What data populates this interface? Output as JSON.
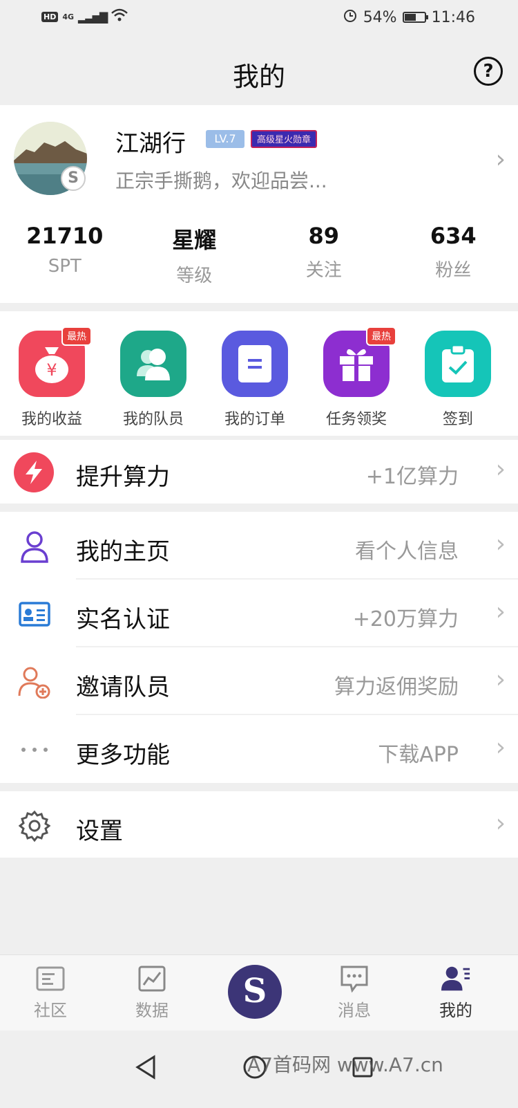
{
  "status_bar": {
    "left_badge": "HD",
    "network": "4G",
    "battery": "54%",
    "time": "11:46"
  },
  "header": {
    "title": "我的",
    "help_label": "?"
  },
  "profile": {
    "name": "江湖行",
    "level_badge": "LV.7",
    "medal_badge": "高级星火勋章",
    "motto": "正宗手撕鹅，欢迎品尝...",
    "stats": [
      {
        "value": "21710",
        "label": "SPT"
      },
      {
        "value": "星耀",
        "label": "等级"
      },
      {
        "value": "89",
        "label": "关注"
      },
      {
        "value": "634",
        "label": "粉丝"
      }
    ]
  },
  "quick_actions": [
    {
      "label": "我的收益",
      "icon": "money-bag-icon",
      "color": "#f0485c",
      "badge": "最热"
    },
    {
      "label": "我的队员",
      "icon": "team-members-icon",
      "color": "#1ea889",
      "badge": ""
    },
    {
      "label": "我的订单",
      "icon": "order-icon",
      "color": "#5a5adf",
      "badge": ""
    },
    {
      "label": "任务领奖",
      "icon": "gift-icon",
      "color": "#8d2ed0",
      "badge": "最热"
    },
    {
      "label": "签到",
      "icon": "clipboard-check-icon",
      "color": "#15c5b8",
      "badge": ""
    }
  ],
  "boost": {
    "title": "提升算力",
    "value": "+1亿算力",
    "icon": "lightning-icon",
    "color": "#f0485c"
  },
  "menu": [
    {
      "title": "我的主页",
      "value": "看个人信息",
      "icon": "person-icon",
      "color": "#6a3fd0"
    },
    {
      "title": "实名认证",
      "value": "+20万算力",
      "icon": "id-card-icon",
      "color": "#2a7bd6"
    },
    {
      "title": "邀请队员",
      "value": "算力返佣奖励",
      "icon": "add-person-icon",
      "color": "#e07a5a"
    },
    {
      "title": "更多功能",
      "value": "下载APP",
      "icon": "more-dots-icon",
      "color": "#999999"
    }
  ],
  "settings": {
    "title": "设置",
    "icon": "gear-icon"
  },
  "tabbar": {
    "tabs": [
      {
        "label": "社区",
        "icon": "community-icon"
      },
      {
        "label": "数据",
        "icon": "chart-icon"
      },
      {
        "label": "消息",
        "icon": "message-icon"
      },
      {
        "label": "我的",
        "icon": "profile-icon"
      }
    ],
    "center_symbol": "S",
    "active_index": 3
  },
  "watermark": "A7首码网 www.A7.cn",
  "colors": {
    "accent": "#3c3577",
    "page_bg": "#efefef"
  }
}
